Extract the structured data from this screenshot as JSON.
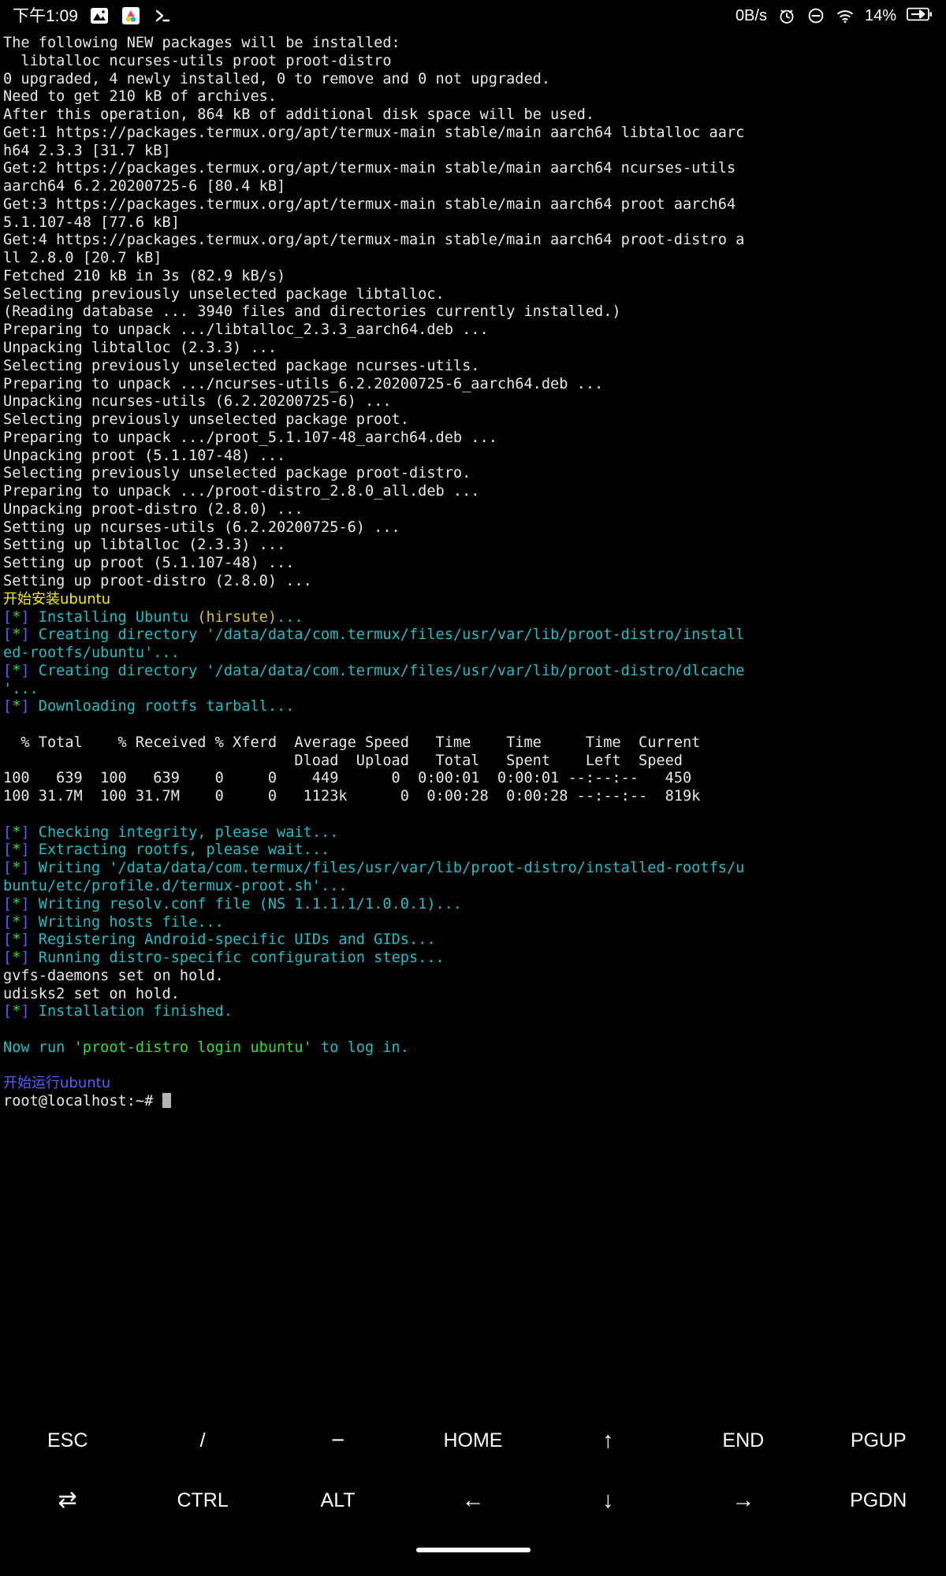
{
  "status_bar": {
    "clock": "下午1:09",
    "app_icons": [
      "gallery-icon",
      "aurora-store-icon",
      "termux-icon"
    ],
    "network_speed": "0B/s",
    "right_icons": [
      "alarm-icon",
      "do-not-disturb-icon",
      "wifi-icon"
    ],
    "battery_percent": "14%",
    "battery_state": "charging"
  },
  "colors": {
    "background": "#000000",
    "foreground": "#e8e8e8",
    "cyan": "#1ac0c6",
    "green": "#2ee02e",
    "yellow": "#f2f200",
    "blue": "#5c5cff",
    "cursor": "#b4b4b4"
  },
  "terminal": {
    "prompt": "root@localhost:~#",
    "cursor_visible": true,
    "lines": [
      {
        "segments": [
          {
            "t": "The following NEW packages will be installed:",
            "c": "white"
          }
        ]
      },
      {
        "segments": [
          {
            "t": "  libtalloc ncurses-utils proot proot-distro",
            "c": "white"
          }
        ]
      },
      {
        "segments": [
          {
            "t": "0 upgraded, 4 newly installed, 0 to remove and 0 not upgraded.",
            "c": "white"
          }
        ]
      },
      {
        "segments": [
          {
            "t": "Need to get 210 kB of archives.",
            "c": "white"
          }
        ]
      },
      {
        "segments": [
          {
            "t": "After this operation, 864 kB of additional disk space will be used.",
            "c": "white"
          }
        ]
      },
      {
        "segments": [
          {
            "t": "Get:1 https://packages.termux.org/apt/termux-main stable/main aarch64 libtalloc aarc",
            "c": "white"
          }
        ]
      },
      {
        "segments": [
          {
            "t": "h64 2.3.3 [31.7 kB]",
            "c": "white"
          }
        ]
      },
      {
        "segments": [
          {
            "t": "Get:2 https://packages.termux.org/apt/termux-main stable/main aarch64 ncurses-utils",
            "c": "white"
          }
        ]
      },
      {
        "segments": [
          {
            "t": "aarch64 6.2.20200725-6 [80.4 kB]",
            "c": "white"
          }
        ]
      },
      {
        "segments": [
          {
            "t": "Get:3 https://packages.termux.org/apt/termux-main stable/main aarch64 proot aarch64",
            "c": "white"
          }
        ]
      },
      {
        "segments": [
          {
            "t": "5.1.107-48 [77.6 kB]",
            "c": "white"
          }
        ]
      },
      {
        "segments": [
          {
            "t": "Get:4 https://packages.termux.org/apt/termux-main stable/main aarch64 proot-distro a",
            "c": "white"
          }
        ]
      },
      {
        "segments": [
          {
            "t": "ll 2.8.0 [20.7 kB]",
            "c": "white"
          }
        ]
      },
      {
        "segments": [
          {
            "t": "Fetched 210 kB in 3s (82.9 kB/s)",
            "c": "white"
          }
        ]
      },
      {
        "segments": [
          {
            "t": "Selecting previously unselected package libtalloc.",
            "c": "white"
          }
        ]
      },
      {
        "segments": [
          {
            "t": "(Reading database ... 3940 files and directories currently installed.)",
            "c": "white"
          }
        ]
      },
      {
        "segments": [
          {
            "t": "Preparing to unpack .../libtalloc_2.3.3_aarch64.deb ...",
            "c": "white"
          }
        ]
      },
      {
        "segments": [
          {
            "t": "Unpacking libtalloc (2.3.3) ...",
            "c": "white"
          }
        ]
      },
      {
        "segments": [
          {
            "t": "Selecting previously unselected package ncurses-utils.",
            "c": "white"
          }
        ]
      },
      {
        "segments": [
          {
            "t": "Preparing to unpack .../ncurses-utils_6.2.20200725-6_aarch64.deb ...",
            "c": "white"
          }
        ]
      },
      {
        "segments": [
          {
            "t": "Unpacking ncurses-utils (6.2.20200725-6) ...",
            "c": "white"
          }
        ]
      },
      {
        "segments": [
          {
            "t": "Selecting previously unselected package proot.",
            "c": "white"
          }
        ]
      },
      {
        "segments": [
          {
            "t": "Preparing to unpack .../proot_5.1.107-48_aarch64.deb ...",
            "c": "white"
          }
        ]
      },
      {
        "segments": [
          {
            "t": "Unpacking proot (5.1.107-48) ...",
            "c": "white"
          }
        ]
      },
      {
        "segments": [
          {
            "t": "Selecting previously unselected package proot-distro.",
            "c": "white"
          }
        ]
      },
      {
        "segments": [
          {
            "t": "Preparing to unpack .../proot-distro_2.8.0_all.deb ...",
            "c": "white"
          }
        ]
      },
      {
        "segments": [
          {
            "t": "Unpacking proot-distro (2.8.0) ...",
            "c": "white"
          }
        ]
      },
      {
        "segments": [
          {
            "t": "Setting up ncurses-utils (6.2.20200725-6) ...",
            "c": "white"
          }
        ]
      },
      {
        "segments": [
          {
            "t": "Setting up libtalloc (2.3.3) ...",
            "c": "white"
          }
        ]
      },
      {
        "segments": [
          {
            "t": "Setting up proot (5.1.107-48) ...",
            "c": "white"
          }
        ]
      },
      {
        "segments": [
          {
            "t": "Setting up proot-distro (2.8.0) ...",
            "c": "white"
          }
        ]
      },
      {
        "segments": [
          {
            "t": "开始安装ubuntu",
            "c": "yellow",
            "cjk": true
          }
        ]
      },
      {
        "segments": [
          {
            "t": "[",
            "c": "blue"
          },
          {
            "t": "*",
            "c": "green"
          },
          {
            "t": "] ",
            "c": "blue"
          },
          {
            "t": "Installing Ubuntu ",
            "c": "cyan"
          },
          {
            "t": "(hirsute)",
            "c": "orange"
          },
          {
            "t": "...",
            "c": "cyan"
          }
        ]
      },
      {
        "segments": [
          {
            "t": "[",
            "c": "blue"
          },
          {
            "t": "*",
            "c": "green"
          },
          {
            "t": "] ",
            "c": "blue"
          },
          {
            "t": "Creating directory '/data/data/com.termux/files/usr/var/lib/proot-distro/install",
            "c": "cyan"
          }
        ]
      },
      {
        "segments": [
          {
            "t": "ed-rootfs/ubuntu'...",
            "c": "cyan"
          }
        ]
      },
      {
        "segments": [
          {
            "t": "[",
            "c": "blue"
          },
          {
            "t": "*",
            "c": "green"
          },
          {
            "t": "] ",
            "c": "blue"
          },
          {
            "t": "Creating directory '/data/data/com.termux/files/usr/var/lib/proot-distro/dlcache",
            "c": "cyan"
          }
        ]
      },
      {
        "segments": [
          {
            "t": "'...",
            "c": "cyan"
          }
        ]
      },
      {
        "segments": [
          {
            "t": "[",
            "c": "blue"
          },
          {
            "t": "*",
            "c": "green"
          },
          {
            "t": "] ",
            "c": "blue"
          },
          {
            "t": "Downloading rootfs tarball...",
            "c": "cyan"
          }
        ]
      },
      {
        "segments": [
          {
            "t": "",
            "c": "white"
          }
        ]
      },
      {
        "segments": [
          {
            "t": "  % Total    % Received % Xferd  Average Speed   Time    Time     Time  Current",
            "c": "white"
          }
        ]
      },
      {
        "segments": [
          {
            "t": "                                 Dload  Upload   Total   Spent    Left  Speed",
            "c": "white"
          }
        ]
      },
      {
        "segments": [
          {
            "t": "100   639  100   639    0     0    449      0  0:00:01  0:00:01 --:--:--   450",
            "c": "white"
          }
        ]
      },
      {
        "segments": [
          {
            "t": "100 31.7M  100 31.7M    0     0   1123k      0  0:00:28  0:00:28 --:--:--  819k",
            "c": "white"
          }
        ]
      },
      {
        "segments": [
          {
            "t": "",
            "c": "white"
          }
        ]
      },
      {
        "segments": [
          {
            "t": "[",
            "c": "blue"
          },
          {
            "t": "*",
            "c": "green"
          },
          {
            "t": "] ",
            "c": "blue"
          },
          {
            "t": "Checking integrity, please wait...",
            "c": "cyan"
          }
        ]
      },
      {
        "segments": [
          {
            "t": "[",
            "c": "blue"
          },
          {
            "t": "*",
            "c": "green"
          },
          {
            "t": "] ",
            "c": "blue"
          },
          {
            "t": "Extracting rootfs, please wait...",
            "c": "cyan"
          }
        ]
      },
      {
        "segments": [
          {
            "t": "[",
            "c": "blue"
          },
          {
            "t": "*",
            "c": "green"
          },
          {
            "t": "] ",
            "c": "blue"
          },
          {
            "t": "Writing '/data/data/com.termux/files/usr/var/lib/proot-distro/installed-rootfs/u",
            "c": "cyan"
          }
        ]
      },
      {
        "segments": [
          {
            "t": "buntu/etc/profile.d/termux-proot.sh'...",
            "c": "cyan"
          }
        ]
      },
      {
        "segments": [
          {
            "t": "[",
            "c": "blue"
          },
          {
            "t": "*",
            "c": "green"
          },
          {
            "t": "] ",
            "c": "blue"
          },
          {
            "t": "Writing resolv.conf file (NS 1.1.1.1/1.0.0.1)...",
            "c": "cyan"
          }
        ]
      },
      {
        "segments": [
          {
            "t": "[",
            "c": "blue"
          },
          {
            "t": "*",
            "c": "green"
          },
          {
            "t": "] ",
            "c": "blue"
          },
          {
            "t": "Writing hosts file...",
            "c": "cyan"
          }
        ]
      },
      {
        "segments": [
          {
            "t": "[",
            "c": "blue"
          },
          {
            "t": "*",
            "c": "green"
          },
          {
            "t": "] ",
            "c": "blue"
          },
          {
            "t": "Registering Android-specific UIDs and GIDs...",
            "c": "cyan"
          }
        ]
      },
      {
        "segments": [
          {
            "t": "[",
            "c": "blue"
          },
          {
            "t": "*",
            "c": "green"
          },
          {
            "t": "] ",
            "c": "blue"
          },
          {
            "t": "Running distro-specific configuration steps...",
            "c": "cyan"
          }
        ]
      },
      {
        "segments": [
          {
            "t": "gvfs-daemons set on hold.",
            "c": "white"
          }
        ]
      },
      {
        "segments": [
          {
            "t": "udisks2 set on hold.",
            "c": "white"
          }
        ]
      },
      {
        "segments": [
          {
            "t": "[",
            "c": "blue"
          },
          {
            "t": "*",
            "c": "green"
          },
          {
            "t": "] ",
            "c": "blue"
          },
          {
            "t": "Installation finished.",
            "c": "cyan"
          }
        ]
      },
      {
        "segments": [
          {
            "t": "",
            "c": "white"
          }
        ]
      },
      {
        "segments": [
          {
            "t": "Now run ",
            "c": "cyan"
          },
          {
            "t": "'proot-distro login ubuntu'",
            "c": "green"
          },
          {
            "t": " to log in.",
            "c": "cyan"
          }
        ]
      },
      {
        "segments": [
          {
            "t": "",
            "c": "white"
          }
        ]
      },
      {
        "segments": [
          {
            "t": "开始运行ubuntu",
            "c": "blue",
            "cjk": true
          }
        ]
      },
      {
        "segments": [
          {
            "t": "root@localhost:~# ",
            "c": "white"
          },
          {
            "t": "",
            "cursor": true
          }
        ]
      }
    ]
  },
  "extra_keys": {
    "row1": [
      {
        "label": "ESC",
        "name": "key-esc"
      },
      {
        "label": "/",
        "name": "key-slash"
      },
      {
        "label": "−",
        "name": "key-minus"
      },
      {
        "label": "HOME",
        "name": "key-home"
      },
      {
        "label": "↑",
        "name": "key-arrow-up"
      },
      {
        "label": "END",
        "name": "key-end"
      },
      {
        "label": "PGUP",
        "name": "key-pgup"
      }
    ],
    "row2": [
      {
        "label": "⇄",
        "name": "key-tab"
      },
      {
        "label": "CTRL",
        "name": "key-ctrl"
      },
      {
        "label": "ALT",
        "name": "key-alt"
      },
      {
        "label": "←",
        "name": "key-arrow-left"
      },
      {
        "label": "↓",
        "name": "key-arrow-down"
      },
      {
        "label": "→",
        "name": "key-arrow-right"
      },
      {
        "label": "PGDN",
        "name": "key-pgdn"
      }
    ]
  }
}
